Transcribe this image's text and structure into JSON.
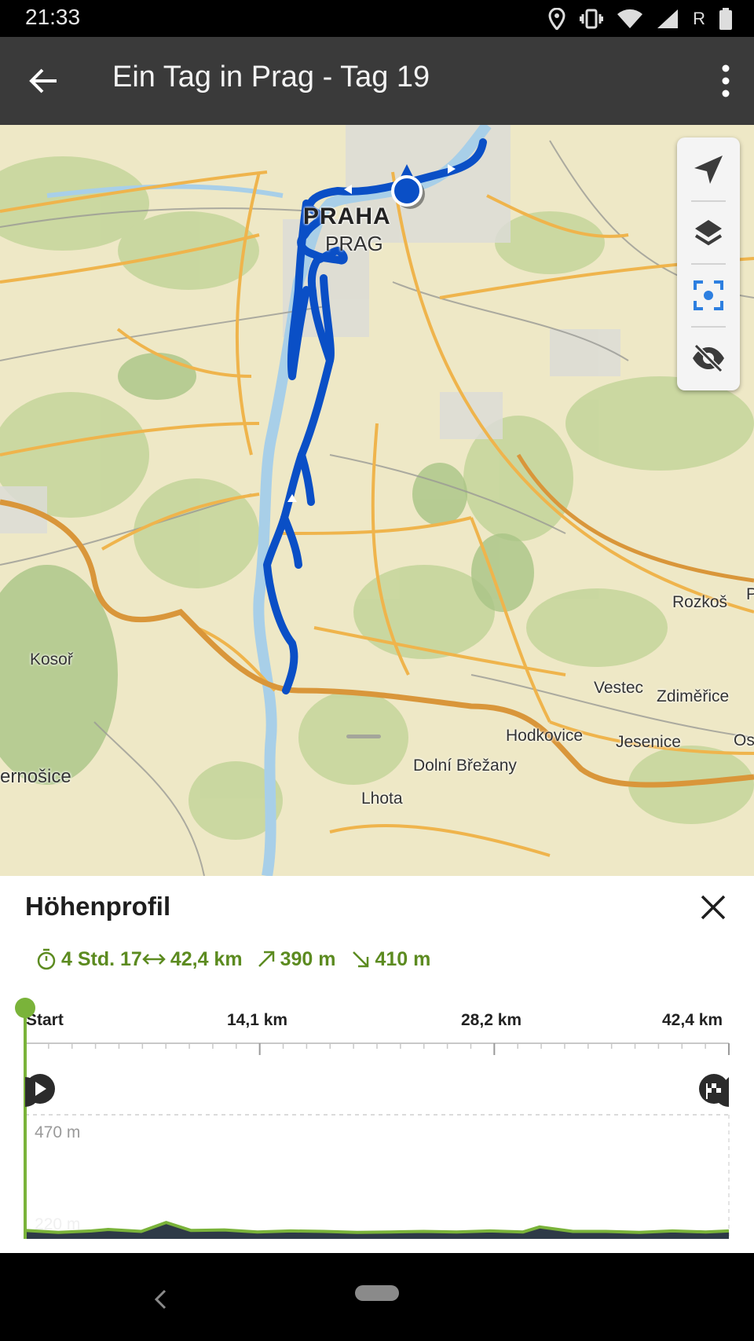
{
  "status_bar": {
    "time": "21:33",
    "icons": [
      "location-icon",
      "vibrate-icon",
      "wifi-icon",
      "cell-signal-icon",
      "roaming-indicator",
      "battery-icon"
    ],
    "roaming": "R"
  },
  "app_bar": {
    "title": "Ein Tag in Prag - Tag 19",
    "back_icon": "arrow-left-icon",
    "menu_icon": "more-vertical-icon"
  },
  "map": {
    "labels": {
      "praha": "PRAHA",
      "prag": "PRAG",
      "rozkos": "Rozkoš",
      "kosor": "Kosoř",
      "vestec": "Vestec",
      "zdimerice": "Zdiměřice",
      "hodkovice": "Hodkovice",
      "jesenice": "Jesenice",
      "os": "Os",
      "dolni_brezany": "Dolní Břežany",
      "cernosice": "ernošice",
      "lhota": "Lhota",
      "p_edge": "P"
    },
    "controls": [
      "navigation-arrow-icon",
      "layers-icon",
      "focus-route-icon",
      "hide-eye-icon"
    ],
    "route_color": "#0a4fc6"
  },
  "elevation": {
    "title": "Höhenprofil",
    "stats": {
      "duration": "4 Std. 17",
      "distance": "42,4 km",
      "ascent": "390 m",
      "descent": "410 m"
    },
    "x_ticks": [
      "Start",
      "14,1 km",
      "28,2 km",
      "42,4 km"
    ],
    "y_labels": {
      "max": "470 m",
      "min": "220 m"
    },
    "accent_color": "#7ab33a",
    "profile_fill": "#2e3a47"
  },
  "chart_data": {
    "type": "area",
    "title": "Höhenprofil",
    "xlabel": "",
    "ylabel": "",
    "x_ticks": [
      "Start",
      "14,1 km",
      "28,2 km",
      "42,4 km"
    ],
    "xlim": [
      0,
      42.4
    ],
    "ylim": [
      220,
      470
    ],
    "x": [
      0,
      2,
      4,
      5,
      7,
      8.5,
      10,
      12,
      14,
      16,
      18,
      20,
      22,
      24,
      26,
      28,
      30,
      31,
      33,
      35,
      37,
      39,
      41,
      42.4
    ],
    "y": [
      237,
      233,
      236,
      239,
      235,
      253,
      237,
      238,
      234,
      236,
      235,
      233,
      234,
      235,
      234,
      236,
      234,
      244,
      235,
      235,
      233,
      236,
      234,
      236
    ]
  }
}
